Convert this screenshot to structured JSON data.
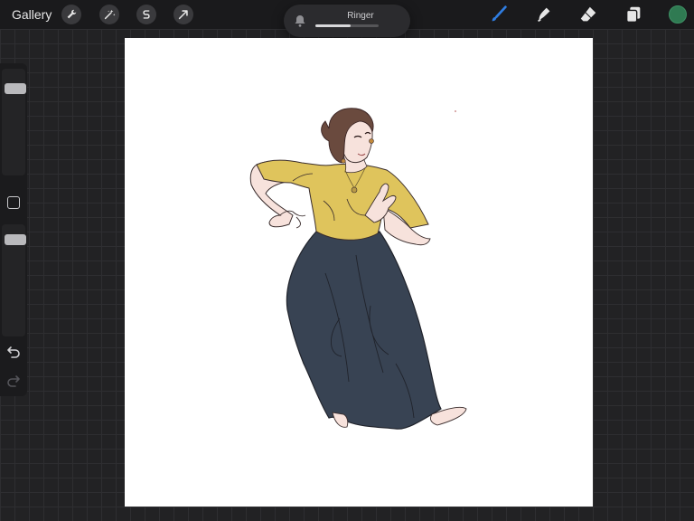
{
  "topbar": {
    "gallery_label": "Gallery",
    "left_tools": [
      "wrench-icon",
      "magic-wand-icon",
      "selection-s-icon",
      "transform-arrow-icon"
    ],
    "right_tools": [
      "brush-icon",
      "smudge-icon",
      "eraser-icon",
      "layers-icon"
    ],
    "active_tool": "brush-icon",
    "active_tool_color": "#2f7de1",
    "current_color": "#2f7a52"
  },
  "ringer": {
    "label": "Ringer",
    "icon": "bell-icon",
    "volume": 0.55
  },
  "sidebar": {
    "brush_size": 0.85,
    "opacity": 0.9,
    "icons": [
      "modify-square-icon",
      "undo-icon",
      "redo-icon"
    ]
  },
  "canvas": {
    "background": "#ffffff"
  }
}
